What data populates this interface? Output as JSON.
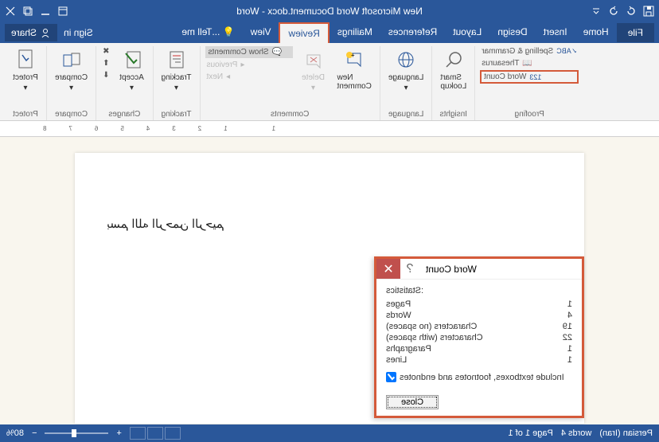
{
  "titlebar": {
    "title": "New Microsoft Word Document.docx - Word"
  },
  "menubar": {
    "share": "Share",
    "signin": "Sign in",
    "tellme": "Tell me...",
    "tabs": {
      "view": "View",
      "review": "Review",
      "mailings": "Mailings",
      "references": "References",
      "layout": "Layout",
      "design": "Design",
      "insert": "Insert",
      "home": "Home"
    },
    "file": "File"
  },
  "ribbon": {
    "protect": {
      "button": "Protect",
      "label": "Protect"
    },
    "compare": {
      "button": "Compare",
      "label": "Compare"
    },
    "changes": {
      "accept": "Accept",
      "label": "Changes"
    },
    "tracking": {
      "button": "Tracking",
      "label": "Tracking"
    },
    "comments": {
      "show": "Show Comments",
      "previous": "Previous",
      "next": "Next",
      "delete": "Delete",
      "new": "New\nComment",
      "label": "Comments"
    },
    "language": {
      "button": "Language",
      "label": "Language"
    },
    "insights": {
      "smart": "Smart\nLookup",
      "label": "Insights"
    },
    "proofing": {
      "spelling": "Spelling & Grammar",
      "thesaurus": "Thesaurus",
      "wordcount": "Word Count",
      "label": "Proofing"
    }
  },
  "document": {
    "text": "بسم الله الرحمن الرحیم"
  },
  "dialog": {
    "title": "Word Count",
    "stats_label": "Statistics:",
    "rows": {
      "pages": {
        "label": "Pages",
        "value": "1"
      },
      "words": {
        "label": "Words",
        "value": "4"
      },
      "chars_ns": {
        "label": "Characters (no spaces)",
        "value": "19"
      },
      "chars_ws": {
        "label": "Characters (with spaces)",
        "value": "22"
      },
      "paragraphs": {
        "label": "Paragraphs",
        "value": "1"
      },
      "lines": {
        "label": "Lines",
        "value": "1"
      }
    },
    "checkbox": "Include textboxes, footnotes and endnotes",
    "close": "Close"
  },
  "statusbar": {
    "zoom": "80%",
    "page": "Page 1 of 1",
    "words": "4 words",
    "lang": "Persian (Iran)"
  }
}
